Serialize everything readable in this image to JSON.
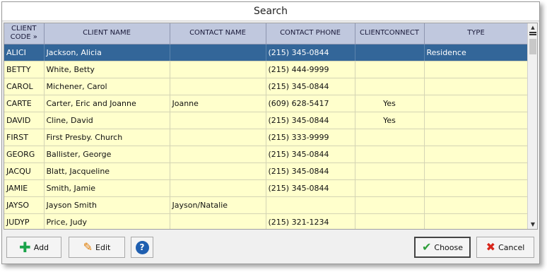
{
  "window": {
    "title": "Search"
  },
  "grid": {
    "columns": [
      "CLIENT CODE »",
      "CLIENT NAME",
      "CONTACT NAME",
      "CONTACT PHONE",
      "CLIENTCONNECT",
      "TYPE"
    ],
    "rows": [
      {
        "code": "ALICI",
        "name": "Jackson, Alicia",
        "contact": "",
        "phone": "(215) 345-0844",
        "connect": "",
        "type": "Residence",
        "selected": true
      },
      {
        "code": "BETTY",
        "name": "White, Betty",
        "contact": "",
        "phone": "(215) 444-9999",
        "connect": "",
        "type": ""
      },
      {
        "code": "CAROL",
        "name": "Michener, Carol",
        "contact": "",
        "phone": "(215) 345-0844",
        "connect": "",
        "type": ""
      },
      {
        "code": "CARTE",
        "name": "Carter, Eric and Joanne",
        "contact": "Joanne",
        "phone": "(609) 628-5417",
        "connect": "Yes",
        "type": ""
      },
      {
        "code": "DAVID",
        "name": "Cline, David",
        "contact": "",
        "phone": "(215) 345-0844",
        "connect": "Yes",
        "type": ""
      },
      {
        "code": "FIRST",
        "name": "First Presby. Church",
        "contact": "",
        "phone": "(215) 333-9999",
        "connect": "",
        "type": ""
      },
      {
        "code": "GEORG",
        "name": "Ballister, George",
        "contact": "",
        "phone": "(215) 345-0844",
        "connect": "",
        "type": ""
      },
      {
        "code": "JACQU",
        "name": "Blatt, Jacqueline",
        "contact": "",
        "phone": "(215) 345-0844",
        "connect": "",
        "type": ""
      },
      {
        "code": "JAMIE",
        "name": "Smith, Jamie",
        "contact": "",
        "phone": "(215) 345-0844",
        "connect": "",
        "type": ""
      },
      {
        "code": "JAYSO",
        "name": "Jayson Smith",
        "contact": "Jayson/Natalie",
        "phone": "",
        "connect": "",
        "type": ""
      },
      {
        "code": "JUDYP",
        "name": "Price, Judy",
        "contact": "",
        "phone": "(215) 321-1234",
        "connect": "",
        "type": ""
      }
    ]
  },
  "buttons": {
    "add": "Add",
    "edit": "Edit",
    "help": "?",
    "choose": "Choose",
    "cancel": "Cancel"
  },
  "icons": {
    "add": "plus-icon",
    "edit": "pencil-icon",
    "help": "help-icon",
    "choose": "checkmark-icon",
    "cancel": "x-icon"
  },
  "colors": {
    "header_bg": "#c0c8de",
    "row_bg": "#ffffcc",
    "selected_bg": "#336699"
  }
}
